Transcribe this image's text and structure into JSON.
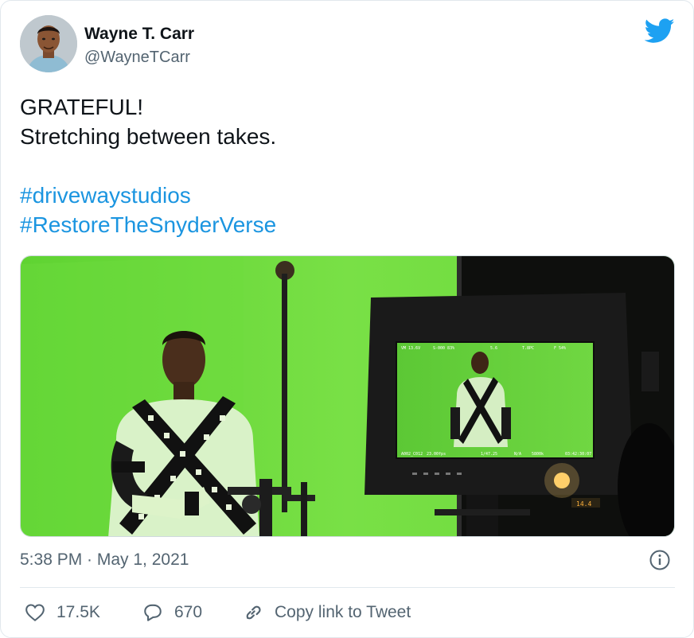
{
  "author": {
    "name": "Wayne T. Carr",
    "handle": "@WayneTCarr"
  },
  "tweet": {
    "lines": [
      "GRATEFUL!",
      "Stretching between takes."
    ],
    "hashtags": [
      "#drivewaystudios",
      "#RestoreTheSnyderVerse"
    ]
  },
  "media": {
    "monitor_overlay": {
      "top": [
        "VM 13.6V",
        "S-000 83%",
        "5.6",
        "T.8PC",
        "F 54%"
      ],
      "bottom": [
        "A002_C012",
        "23.00fps",
        "1/47.25",
        "N/A",
        "5800k",
        "03:42:30:07"
      ]
    },
    "slate_counter": "14.4"
  },
  "timestamp": "5:38 PM · May 1, 2021",
  "actions": {
    "likes": "17.5K",
    "replies": "670",
    "copy_link": "Copy link to Tweet"
  },
  "colors": {
    "twitter_blue": "#1da1f2",
    "hashtag": "#1b95e0",
    "muted": "#536471",
    "greenscreen": "#6fdc3c"
  },
  "icons": [
    "twitter-bird-icon",
    "info-icon",
    "heart-icon",
    "reply-bubble-icon",
    "link-icon"
  ]
}
